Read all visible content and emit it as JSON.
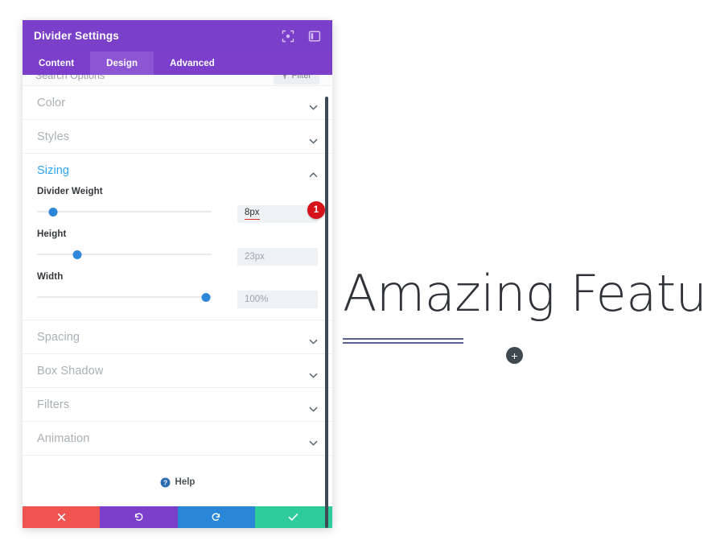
{
  "panel": {
    "title": "Divider Settings",
    "header_icons": [
      {
        "name": "fullscreen-icon"
      },
      {
        "name": "panel-layout-icon"
      }
    ],
    "tabs": [
      {
        "label": "Content",
        "active": false
      },
      {
        "label": "Design",
        "active": true
      },
      {
        "label": "Advanced",
        "active": false
      }
    ],
    "search": {
      "placeholder": "Search Options",
      "filter_label": "Filter"
    },
    "sections": [
      {
        "label": "Color",
        "open": false
      },
      {
        "label": "Styles",
        "open": false
      },
      {
        "label": "Sizing",
        "open": true
      },
      {
        "label": "Spacing",
        "open": false
      },
      {
        "label": "Box Shadow",
        "open": false
      },
      {
        "label": "Filters",
        "open": false
      },
      {
        "label": "Animation",
        "open": false
      }
    ],
    "sizing_fields": [
      {
        "label": "Divider Weight",
        "value": "8px",
        "slider_percent": 9,
        "badge": "1",
        "active": true
      },
      {
        "label": "Height",
        "value": "23px",
        "slider_percent": 23,
        "badge": "",
        "active": false
      },
      {
        "label": "Width",
        "value": "100%",
        "slider_percent": 97,
        "badge": "",
        "active": false
      }
    ],
    "help_label": "Help",
    "footer_buttons": [
      {
        "name": "cancel-button",
        "icon": "close-icon",
        "color": "#ef5350"
      },
      {
        "name": "undo-button",
        "icon": "undo-icon",
        "color": "#7b3fcb"
      },
      {
        "name": "redo-button",
        "icon": "redo-icon",
        "color": "#2a87d8"
      },
      {
        "name": "save-button",
        "icon": "check-icon",
        "color": "#2ecc9b"
      }
    ]
  },
  "content": {
    "heading": "Amazing Features",
    "divider_color": "#5b6191",
    "add_button_label": "+"
  }
}
